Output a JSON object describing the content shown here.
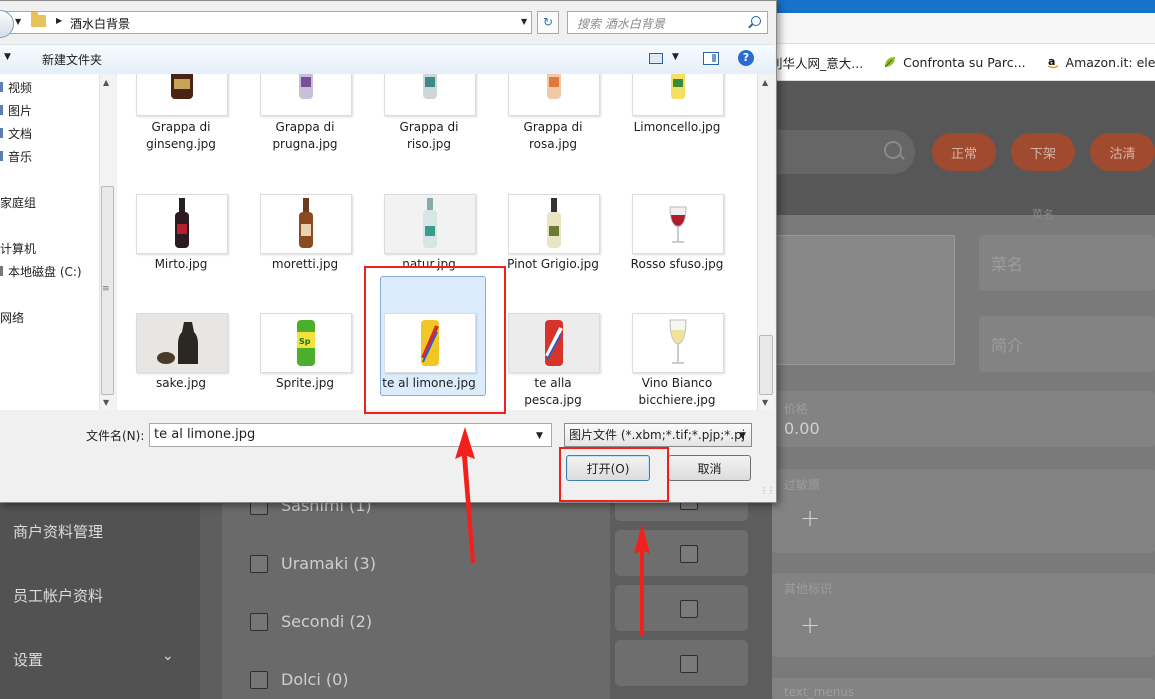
{
  "dialog": {
    "address_path": "酒水白背景",
    "search_placeholder": "搜索 酒水白背景",
    "toolbar": {
      "new_folder": "新建文件夹"
    },
    "nav_items": [
      "视频",
      "图片",
      "文档",
      "音乐",
      "家庭组",
      "计算机",
      "本地磁盘 (C:)",
      "网络"
    ],
    "files": [
      {
        "name": "Grappa di ginseng.jpg",
        "line1": "Grappa di",
        "line2": "ginseng.jpg"
      },
      {
        "name": "Grappa di prugna.jpg",
        "line1": "Grappa di",
        "line2": "prugna.jpg"
      },
      {
        "name": "Grappa di riso.jpg",
        "line1": "Grappa di",
        "line2": "riso.jpg"
      },
      {
        "name": "Grappa di rosa.jpg",
        "line1": "Grappa di",
        "line2": "rosa.jpg"
      },
      {
        "name": "Limoncello.jpg",
        "line1": "Limoncello.jpg",
        "line2": ""
      },
      {
        "name": "Mirto.jpg",
        "line1": "Mirto.jpg",
        "line2": ""
      },
      {
        "name": "moretti.jpg",
        "line1": "moretti.jpg",
        "line2": ""
      },
      {
        "name": "natur.jpg",
        "line1": "natur.jpg",
        "line2": ""
      },
      {
        "name": "Pinot Grigio.jpg",
        "line1": "Pinot Grigio.jpg",
        "line2": ""
      },
      {
        "name": "Rosso sfuso.jpg",
        "line1": "Rosso sfuso.jpg",
        "line2": ""
      },
      {
        "name": "sake.jpg",
        "line1": "sake.jpg",
        "line2": ""
      },
      {
        "name": "Sprite.jpg",
        "line1": "Sprite.jpg",
        "line2": ""
      },
      {
        "name": "te al limone.jpg",
        "line1": "te al limone.jpg",
        "line2": ""
      },
      {
        "name": "te alla pesca.jpg",
        "line1": "te alla",
        "line2": "pesca.jpg"
      },
      {
        "name": "Vino Bianco bicchiere.jpg",
        "line1": "Vino Bianco",
        "line2": "bicchiere.jpg"
      }
    ],
    "selected_file": "te al limone.jpg",
    "filename_label": "文件名(N):",
    "filename_value": "te al limone.jpg",
    "file_type": "图片文件 (*.xbm;*.tif;*.pjp;*.pj",
    "open_button": "打开(O)",
    "cancel_button": "取消"
  },
  "browser": {
    "bookmarks": [
      {
        "label": "利华人网_意大...",
        "icon": "site-icon"
      },
      {
        "label": "Confronta su Parc...",
        "icon": "leaf-icon"
      },
      {
        "label": "Amazon.it: elettr",
        "icon": "amazon-icon"
      }
    ]
  },
  "app": {
    "status_buttons": [
      "正常",
      "下架",
      "沽清"
    ],
    "field_top_label": "菜名",
    "name_placeholder": "菜名",
    "desc_placeholder": "简介",
    "price_label": "价格",
    "price_value": "0.00",
    "allergen_label": "过敏原",
    "other_label": "其他标识",
    "text_menus_label": "text_menus",
    "sidebar": [
      {
        "label": "商户资料管理"
      },
      {
        "label": "员工帐户资料"
      },
      {
        "label": "设置"
      }
    ],
    "categories": [
      {
        "label": "Sashimi (1)"
      },
      {
        "label": "Uramaki (3)"
      },
      {
        "label": "Secondi (2)"
      },
      {
        "label": "Dolci (0)"
      }
    ]
  },
  "colors": {
    "annotation_red": "#f2201c",
    "selection_blue": "#dcecfc",
    "status_pill": "#a04a30"
  }
}
